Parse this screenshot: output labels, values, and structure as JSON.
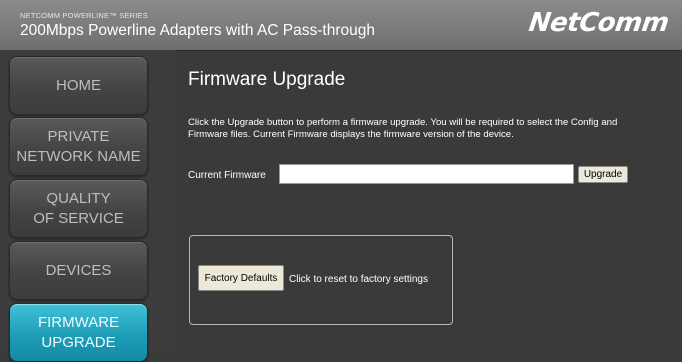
{
  "header": {
    "series": "NETCOMM POWERLINE™ SERIES",
    "product": "200Mbps Powerline Adapters with AC Pass-through",
    "logo": "NetComm"
  },
  "nav": {
    "items": [
      {
        "lines": [
          "HOME"
        ]
      },
      {
        "lines": [
          "PRIVATE",
          "NETWORK NAME"
        ]
      },
      {
        "lines": [
          "QUALITY",
          "OF SERVICE"
        ]
      },
      {
        "lines": [
          "DEVICES"
        ]
      },
      {
        "lines": [
          "FIRMWARE",
          "UPGRADE"
        ]
      }
    ],
    "active_index": 4
  },
  "main": {
    "title": "Firmware Upgrade",
    "description": "Click the Upgrade button to perform a firmware upgrade. You will be required to select the Config and Firmware files. Current Firmware displays the firmware version of the device.",
    "current_firmware_label": "Current Firmware",
    "current_firmware_value": "",
    "upgrade_label": "Upgrade",
    "factory_defaults_label": "Factory Defaults",
    "factory_defaults_text": "Click to reset to factory settings"
  },
  "colors": {
    "header_bg": "#7d7d7d",
    "page_bg": "#3a3a3a",
    "active_nav": "#1e9db7"
  }
}
